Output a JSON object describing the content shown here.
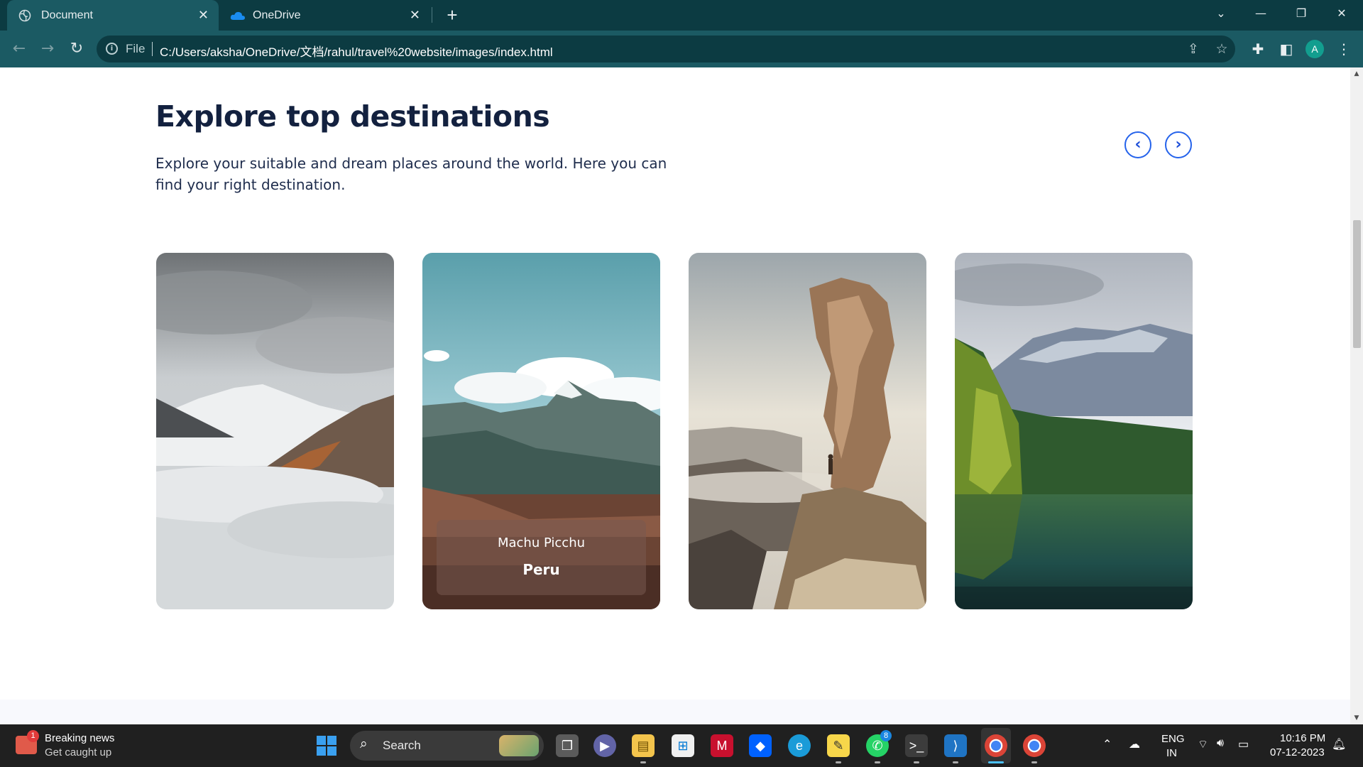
{
  "browser": {
    "tabs": [
      {
        "title": "Document",
        "close": "✕"
      },
      {
        "title": "OneDrive",
        "close": "✕"
      }
    ],
    "new_tab": "+",
    "file_label": "File",
    "url": "C:/Users/aksha/OneDrive/文档/rahul/travel%20website/images/index.html",
    "profile_initial": "A"
  },
  "page": {
    "heading": "Explore top destinations",
    "description": "Explore your suitable and dream places around the world. Here you can find your right destination.",
    "prev_label": "‹",
    "next_label": "›",
    "cards": [
      {
        "image": "foggy-mountain-forest"
      },
      {
        "image": "andes-mountains",
        "place": "Machu Picchu",
        "country": "Peru"
      },
      {
        "image": "canyon-rock-pillar"
      },
      {
        "image": "alpine-lake-forest"
      }
    ]
  },
  "taskbar": {
    "news_title": "Breaking news",
    "news_sub": "Get caught up",
    "news_badge": "1",
    "search_label": "Search",
    "whatsapp_badge": "8",
    "lang_line1": "ENG",
    "lang_line2": "IN",
    "time": "10:16 PM",
    "date": "07-12-2023"
  }
}
